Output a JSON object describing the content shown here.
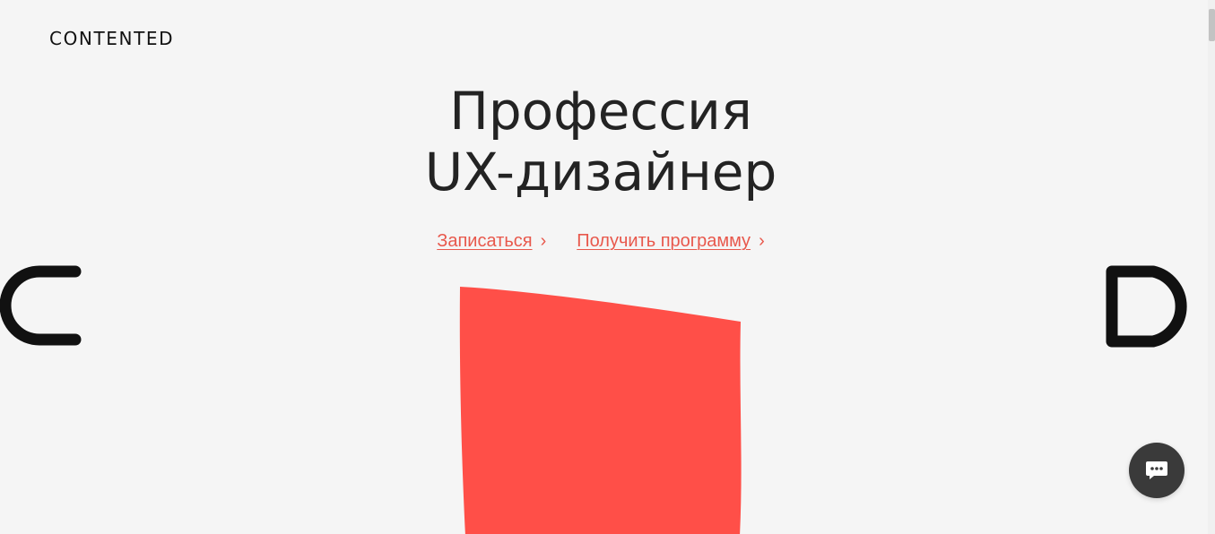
{
  "header": {
    "logo_text": "CONTENTED"
  },
  "hero": {
    "title_line1": "Профессия",
    "title_line2": "UX-дизайнер",
    "cta_primary": {
      "label": "Записаться",
      "arrow": "›"
    },
    "cta_secondary": {
      "label": "Получить программу",
      "arrow": "›"
    }
  },
  "decor": {
    "left_letter": "C",
    "right_letter": "D",
    "accent_color": "#ff4f48",
    "icons": [
      "letter-c-icon",
      "letter-d-icon",
      "chat-icon"
    ]
  },
  "colors": {
    "background": "#f5f5f5",
    "link": "#e8584c",
    "text": "#232323",
    "chat_button": "#3a3a3a"
  }
}
